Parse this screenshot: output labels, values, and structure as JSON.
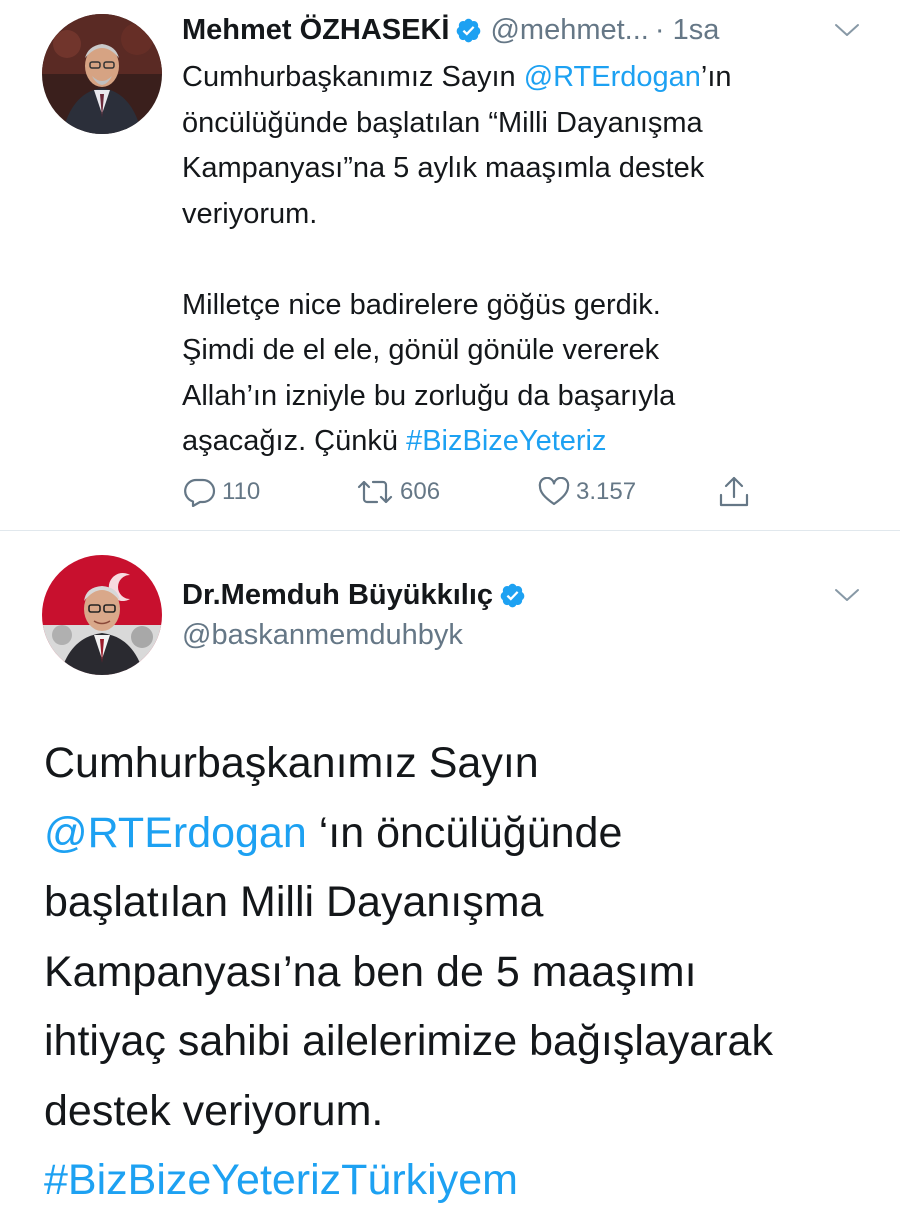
{
  "tweet1": {
    "author_name": "Mehmet ÖZHASEKİ",
    "handle": "@mehmet...",
    "time": "· 1sa",
    "text_lines": [
      {
        "before": "Cumhurbaşkanımız Sayın ",
        "mention": "@RTErdogan",
        "after": "’ın"
      },
      "öncülüğünde başlatılan “Milli Dayanışma",
      "Kampanyası”na 5 aylık maaşımla destek",
      "veriyorum.",
      "Milletçe nice badirelere göğüs gerdik.",
      "Şimdi de el ele, gönül gönüle vererek",
      "Allah’ın izniyle bu zorluğu da başarıyla",
      {
        "before": "aşacağız. Çünkü ",
        "hashtag": "#BizBizeYeteriz"
      }
    ],
    "reply_count": "110",
    "retweet_count": "606",
    "like_count": "3.157",
    "icons": {
      "reply": "reply-icon",
      "retweet": "retweet-icon",
      "like": "heart-icon",
      "share": "share-icon",
      "verified": "verified-badge-icon",
      "menu": "chevron-down-icon"
    }
  },
  "tweet2": {
    "author_name": "Dr.Memduh Büyükkılıç",
    "handle": "@baskanmemduhbyk",
    "text_lines": [
      "Cumhurbaşkanımız Sayın",
      {
        "mention": "@RTErdogan",
        "after": " ‘ın öncülüğünde"
      },
      "başlatılan Milli Dayanışma",
      "Kampanyası’na ben de 5 maaşımı",
      "ihtiyaç sahibi ailelerimize bağışlayarak",
      "destek veriyorum.",
      {
        "hashtag": "#BizBizeYeterizTürkiyem"
      }
    ]
  },
  "colors": {
    "link": "#1da1f2",
    "secondary_text": "#657786",
    "primary_text": "#14171a",
    "divider": "#e1e8ed",
    "verified": "#1da1f2"
  }
}
